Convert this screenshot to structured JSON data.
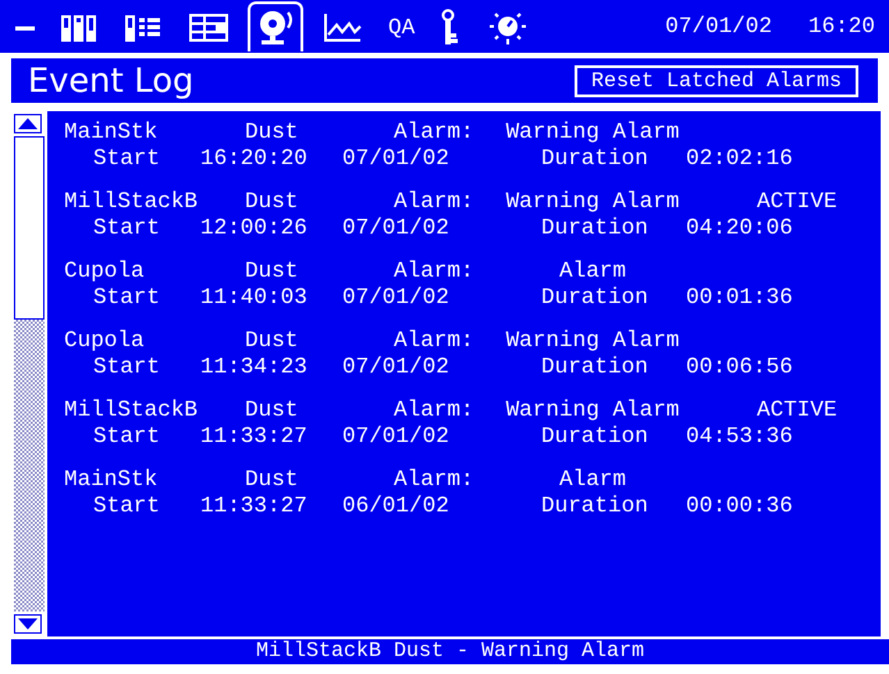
{
  "toolbar": {
    "tabs": [
      {
        "selected": false
      },
      {
        "selected": false
      },
      {
        "selected": false
      },
      {
        "selected": false
      },
      {
        "selected": true
      },
      {
        "selected": false
      },
      {
        "label": "QA",
        "selected": false
      },
      {
        "selected": false
      },
      {
        "selected": false
      }
    ],
    "date": "07/01/02",
    "time": "16:20"
  },
  "title": "Event Log",
  "reset_button": "Reset Latched Alarms",
  "events": [
    {
      "source": "MainStk",
      "type": "Dust",
      "alarm_label": "Alarm:",
      "alarm": "Warning Alarm",
      "start_label": "Start",
      "start_time": "16:20:20",
      "start_date": "07/01/02",
      "duration_label": "Duration",
      "duration": "02:02:16"
    },
    {
      "source": "MillStackB",
      "type": "Dust",
      "alarm_label": "Alarm:",
      "alarm": "Warning Alarm",
      "status": "ACTIVE",
      "start_label": "Start",
      "start_time": "12:00:26",
      "start_date": "07/01/02",
      "duration_label": "Duration",
      "duration": "04:20:06"
    },
    {
      "source": "Cupola",
      "type": "Dust",
      "alarm_label": "Alarm:",
      "alarm": "Alarm",
      "start_label": "Start",
      "start_time": "11:40:03",
      "start_date": "07/01/02",
      "duration_label": "Duration",
      "duration": "00:01:36"
    },
    {
      "source": "Cupola",
      "type": "Dust",
      "alarm_label": "Alarm:",
      "alarm": "Warning Alarm",
      "start_label": "Start",
      "start_time": "11:34:23",
      "start_date": "07/01/02",
      "duration_label": "Duration",
      "duration": "00:06:56"
    },
    {
      "source": "MillStackB",
      "type": "Dust",
      "alarm_label": "Alarm:",
      "alarm": "Warning Alarm",
      "status": "ACTIVE",
      "start_label": "Start",
      "start_time": "11:33:27",
      "start_date": "07/01/02",
      "duration_label": "Duration",
      "duration": "04:53:36"
    },
    {
      "source": "MainStk",
      "type": "Dust",
      "alarm_label": "Alarm:",
      "alarm": "Alarm",
      "start_label": "Start",
      "start_time": "11:33:27",
      "start_date": "06/01/02",
      "duration_label": "Duration",
      "duration": "00:00:36"
    }
  ],
  "status_bar": "MillStackB Dust - Warning Alarm"
}
